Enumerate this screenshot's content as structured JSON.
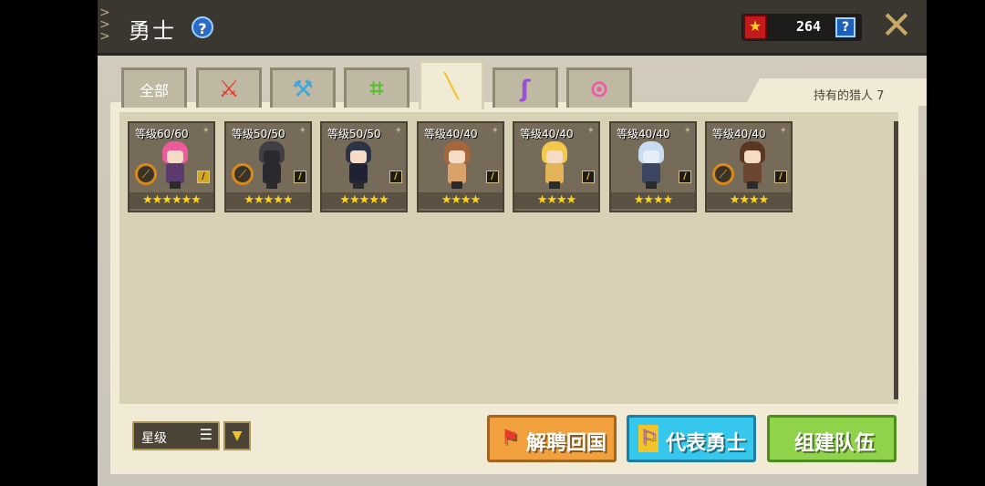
{
  "header": {
    "title": "勇士",
    "help_label": "?",
    "currency_value": "264",
    "currency_help": "?",
    "close_label": "✕"
  },
  "tabs": [
    {
      "label": "全部",
      "icon": "all-text",
      "color": ""
    },
    {
      "label": "",
      "icon": "sword-icon",
      "color": "#e33a2a"
    },
    {
      "label": "",
      "icon": "hammer-icon",
      "color": "#3aa7e0"
    },
    {
      "label": "",
      "icon": "bow-icon",
      "color": "#54c12e"
    },
    {
      "label": "",
      "icon": "rifle-icon",
      "color": "#f0c42a",
      "active": true
    },
    {
      "label": "",
      "icon": "staff-icon",
      "color": "#9b4fd6"
    },
    {
      "label": "",
      "icon": "medallion-icon",
      "color": "#f057a8"
    }
  ],
  "hunter_count_label": "持有的猎人 7",
  "heroes": [
    {
      "level": "等级60/60",
      "stars": "★★★★★★",
      "hair": "#ee5b9c",
      "outfit": "#5b3a6e",
      "weapon": "gold"
    },
    {
      "level": "等级50/50",
      "stars": "★★★★★",
      "hair": "#3e3e44",
      "outfit": "#2a2a2e",
      "weapon": "normal"
    },
    {
      "level": "等级50/50",
      "stars": "★★★★★",
      "hair": "#2d3346",
      "outfit": "#1e2233",
      "weapon": "normal"
    },
    {
      "level": "等级40/40",
      "stars": "★★★★",
      "hair": "#a8673a",
      "outfit": "#d9a26a",
      "weapon": "normal"
    },
    {
      "level": "等级40/40",
      "stars": "★★★★",
      "hair": "#f2c94c",
      "outfit": "#e3b35a",
      "weapon": "normal"
    },
    {
      "level": "等级40/40",
      "stars": "★★★★",
      "hair": "#c8ddf2",
      "outfit": "#3b4760",
      "weapon": "normal"
    },
    {
      "level": "等级40/40",
      "stars": "★★★★",
      "hair": "#5a3624",
      "outfit": "#6b4630",
      "weapon": "normal"
    }
  ],
  "sort": {
    "label": "星级",
    "icon": "list-icon"
  },
  "buttons": {
    "dismiss": "解聘回国",
    "representative": "代表勇士",
    "form_team": "组建队伍"
  }
}
